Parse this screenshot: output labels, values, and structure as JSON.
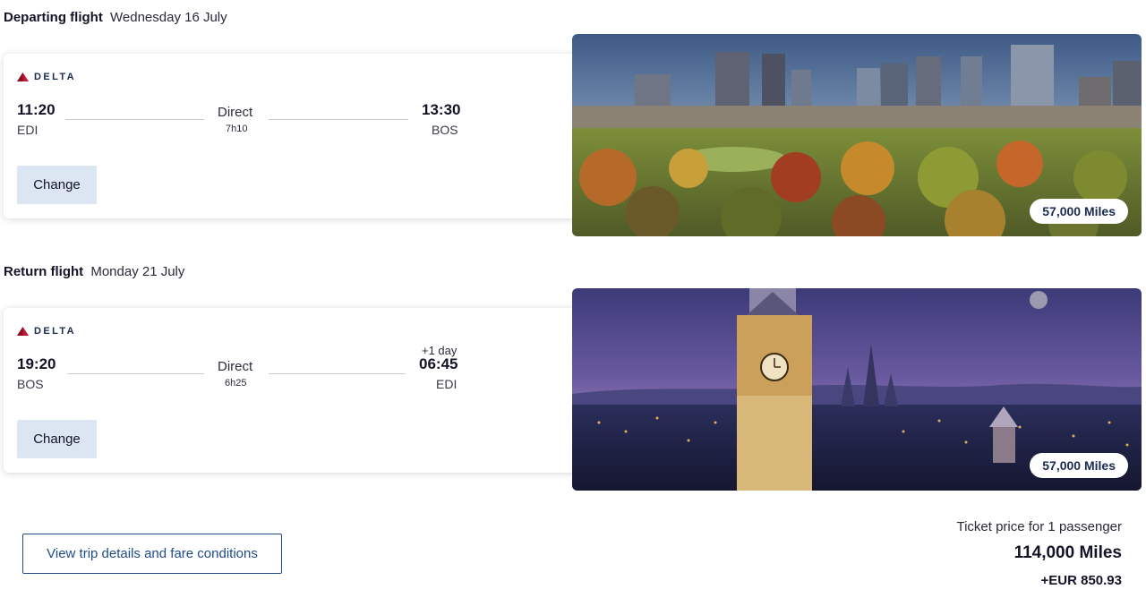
{
  "departing": {
    "label": "Departing flight",
    "date": "Wednesday 16 July",
    "airline": "DELTA",
    "depart_time": "11:20",
    "depart_code": "EDI",
    "stops": "Direct",
    "duration": "7h10",
    "arrive_time": "13:30",
    "arrive_code": "BOS",
    "change_label": "Change",
    "miles": "57,000 Miles",
    "photo_subject": "boston-city-skyline"
  },
  "return": {
    "label": "Return flight",
    "date": "Monday 21 July",
    "airline": "DELTA",
    "depart_time": "19:20",
    "depart_code": "BOS",
    "stops": "Direct",
    "duration": "6h25",
    "plus_day": "+1 day",
    "arrive_time": "06:45",
    "arrive_code": "EDI",
    "change_label": "Change",
    "miles": "57,000 Miles",
    "photo_subject": "edinburgh-clock-tower-night"
  },
  "footer": {
    "view_details_label": "View trip details and fare conditions",
    "price_label": "Ticket price for 1 passenger",
    "price_miles": "114,000 Miles",
    "price_eur": "+EUR 850.93"
  },
  "colors": {
    "brand_navy": "#1a2b50",
    "delta_red": "#c01933",
    "button_bg": "#dce5f2",
    "link_blue": "#1f4b8c"
  }
}
